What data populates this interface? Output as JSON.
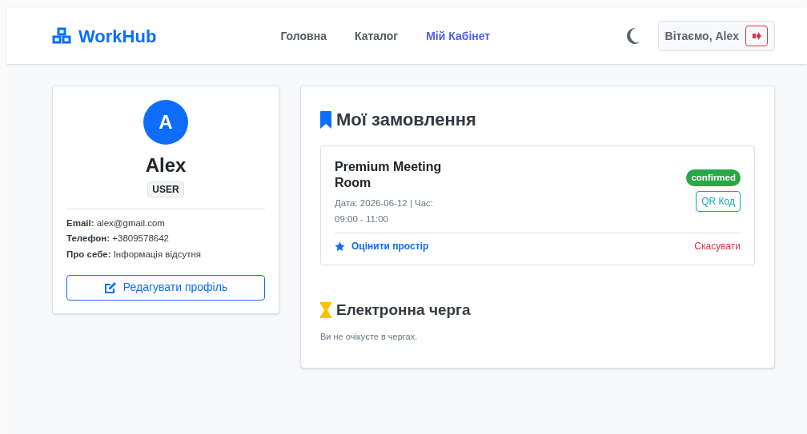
{
  "brand": "WorkHub",
  "nav": [
    {
      "label": "Головна",
      "selected": false
    },
    {
      "label": "Каталог",
      "selected": false
    },
    {
      "label": "Мій Кабінет",
      "selected": true
    }
  ],
  "greeting": "Вітаємо, Alex",
  "profile": {
    "initial": "A",
    "name": "Alex",
    "role": "USER",
    "details": [
      "**Email:** alex@gmail.com",
      "**Телефон:** +3809578642",
      "**Про себе:** Інформація відсутня"
    ],
    "edit_button": "Редагувати профіль"
  },
  "orders": {
    "title": "Мої замовлення",
    "items": [
      {
        "title": "Premium Meeting Room",
        "details": "Дата: 2026-06-12 | Час: 09:00 - 11:00",
        "status": "confirmed",
        "qr_button": "QR Код",
        "rate_link": "Оцінити простір",
        "cancel_link": "Скасувати"
      }
    ]
  },
  "queue": {
    "title": "Електронна черга",
    "message": "Ви не очікуєте в чергах."
  }
}
